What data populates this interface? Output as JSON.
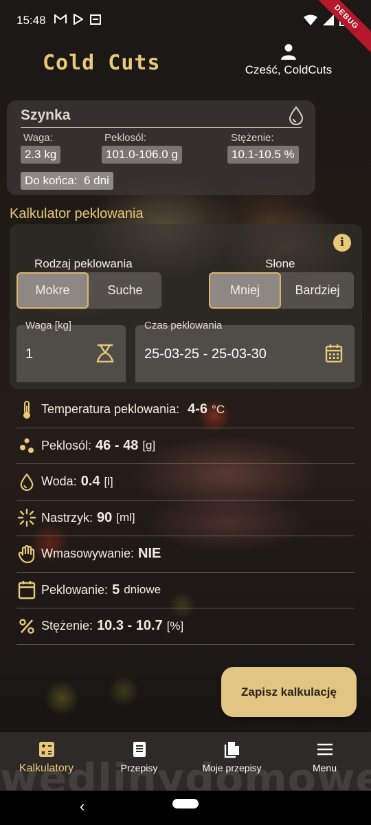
{
  "status_bar": {
    "time": "15:48",
    "debug_label": "DEBUG"
  },
  "header": {
    "app_title": "Cold Cuts",
    "greeting": "Cześć, ColdCuts"
  },
  "product_card": {
    "title": "Szynka",
    "weight_label": "Waga:",
    "weight_value": "2.3 kg",
    "salt_label": "Peklosól:",
    "salt_value": "101.0-106.0 g",
    "concentration_label": "Stężenie:",
    "concentration_value": "10.1-10.5 %",
    "remaining": "Do końca:  6 dni"
  },
  "calculator": {
    "title": "Kalkulator peklowania",
    "curing_type_label": "Rodzaj peklowania",
    "curing_type_options": [
      "Mokre",
      "Suche"
    ],
    "curing_type_selected": "Mokre",
    "saltiness_label": "Słone",
    "saltiness_options": [
      "Mniej",
      "Bardziej"
    ],
    "saltiness_selected": "Mniej",
    "weight_field_label": "Waga [kg]",
    "weight_field_value": "1",
    "time_field_label": "Czas peklowania",
    "time_field_value": "25-03-25 - 25-03-30"
  },
  "results": [
    {
      "icon": "thermometer-icon",
      "label": "Temperatura peklowania:",
      "value": "4-6",
      "unit": "°C"
    },
    {
      "icon": "salt-icon",
      "label": "Peklosól:",
      "value": "46 - 48",
      "unit": "[g]"
    },
    {
      "icon": "water-drop-icon",
      "label": "Woda:",
      "value": "0.4",
      "unit": "[l]"
    },
    {
      "icon": "injection-icon",
      "label": "Nastrzyk:",
      "value": "90",
      "unit": "[ml]"
    },
    {
      "icon": "hand-icon",
      "label": "Wmasowywanie:",
      "value": "NIE",
      "unit": ""
    },
    {
      "icon": "calendar-icon",
      "label": "Peklowanie:",
      "value": "5",
      "unit": "dniowe"
    },
    {
      "icon": "percent-icon",
      "label": "Stężenie:",
      "value": "10.3 - 10.7",
      "unit": "[%]"
    }
  ],
  "save_button": "Zapisz kalkulację",
  "bottom_nav": [
    {
      "icon": "calculator-icon",
      "label": "Kalkulatory",
      "active": true
    },
    {
      "icon": "recipes-icon",
      "label": "Przepisy",
      "active": false
    },
    {
      "icon": "my-recipes-icon",
      "label": "Moje przepisy",
      "active": false
    },
    {
      "icon": "menu-icon",
      "label": "Menu",
      "active": false
    }
  ],
  "watermark": "wedlinydomowe.pl",
  "colors": {
    "accent": "#e8c97a",
    "button": "#e3c583",
    "selected_border": "#d9b66c"
  }
}
